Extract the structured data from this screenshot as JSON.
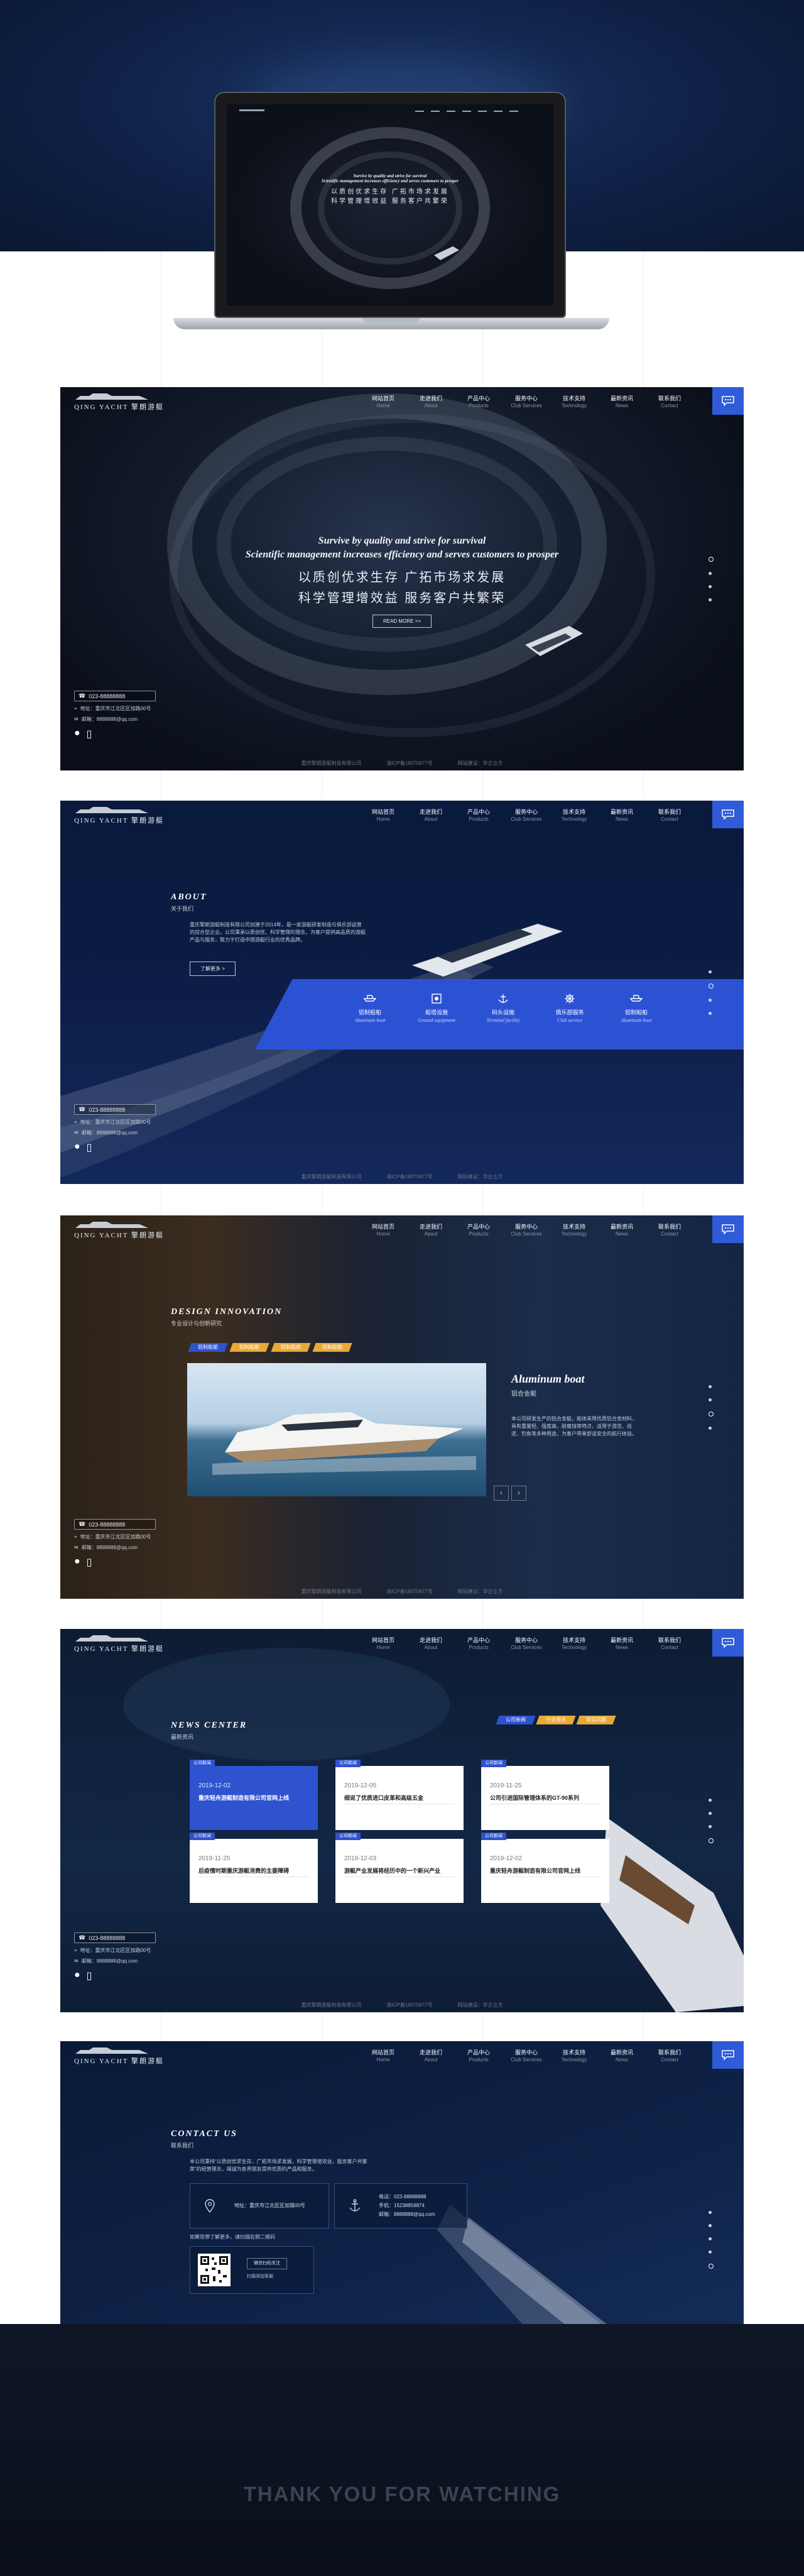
{
  "brand": {
    "name": "QING YACHT 擎朗游艇"
  },
  "nav": [
    {
      "cn": "网站首页",
      "en": "Home"
    },
    {
      "cn": "走进我们",
      "en": "About"
    },
    {
      "cn": "产品中心",
      "en": "Products"
    },
    {
      "cn": "服务中心",
      "en": "Club Services"
    },
    {
      "cn": "技术支持",
      "en": "Technology"
    },
    {
      "cn": "最新资讯",
      "en": "News"
    },
    {
      "cn": "联系我们",
      "en": "Contact"
    }
  ],
  "contact_box": {
    "phone": "023-88888888",
    "address": "地址：重庆市江北区区加路00号",
    "email": "邮箱：8888888@qq.com"
  },
  "footer": [
    "重庆擎朗游艇制造有限公司",
    "渝ICP备18070677号",
    "网站建设：华企立方"
  ],
  "hero": {
    "line1": "Survive by quality and strive for survival",
    "line2": "Scientific management increases efficiency and serves customers to prosper",
    "cn1": "以质创优求生存  广拓市场求发展",
    "cn2": "科学管理增效益  服务客户共繁荣",
    "button": "READ MORE >>"
  },
  "about": {
    "title_en": "ABOUT",
    "title_cn": "关于我们",
    "text": "重庆擎朗游艇制造有限公司创建于2014年，是一家游艇研发制造与俱乐部运营的综合型企业。公司秉承以质创优、科学管理的理念，为客户提供高品质的游艇产品与服务，致力于打造中国游艇行业的优秀品牌。",
    "more": "了解更多 >",
    "features": [
      {
        "cn": "铝制船舶",
        "en": "Aluminum boat"
      },
      {
        "cn": "船塔设施",
        "en": "Ground equipment"
      },
      {
        "cn": "码头设施",
        "en": "Terminal facility"
      },
      {
        "cn": "俱乐部服务",
        "en": "Club service"
      },
      {
        "cn": "铝制船舶",
        "en": "Aluminum boat"
      }
    ]
  },
  "design": {
    "title_en": "DESIGN INNOVATION",
    "title_cn": "专业设计与创新研究",
    "tabs": [
      "铝制船舶",
      "铝制船舶",
      "铝制船舶",
      "铝制船舶"
    ],
    "product_en": "Aluminum boat",
    "product_cn": "铝合金艇",
    "product_desc": "本公司研发生产的铝合金艇，船体采用优质铝合金材料，具有重量轻、强度高、耐腐蚀等特点，适用于游览、巡逻、钓鱼等多种用途，为客户带来舒适安全的航行体验。"
  },
  "news": {
    "title_en": "NEWS CENTER",
    "title_cn": "最新资讯",
    "tabs": [
      "公司新闻",
      "行业资讯",
      "常见问题"
    ],
    "cards": [
      {
        "badge": "公司新闻",
        "date": "2019-12-02",
        "title": "重庆轻舟游艇制造有限公司官网上线"
      },
      {
        "badge": "公司新闻",
        "date": "2019-12-05",
        "title": "细说了优质进口皮革和高级五金"
      },
      {
        "badge": "公司新闻",
        "date": "2019-11-25",
        "title": "公司引进国际管理体系的GT-90系列"
      },
      {
        "badge": "公司新闻",
        "date": "2019-11-25",
        "title": "后疫情时期重庆游艇消费的主要障碍"
      },
      {
        "badge": "公司新闻",
        "date": "2019-12-03",
        "title": "游艇产业发展将经历中的一个新兴产业"
      },
      {
        "badge": "公司新闻",
        "date": "2019-12-02",
        "title": "重庆轻舟游艇制造有限公司官网上线"
      }
    ]
  },
  "contact": {
    "title_en": "CONTACT US",
    "title_cn": "联系我们",
    "intro": "本公司秉持“以质创优求生存，广拓市场求发展，科学管理增效益，服务客户共繁荣”的经营理念，竭诚为各界朋友提供优质的产品和服务。",
    "address": "地址：重庆市江北区区加路00号",
    "phone": "电话：023-88888888",
    "mobile": "手机：15238859874",
    "email": "邮箱：8888888@qq.com",
    "follow": "如果您想了解更多，请扫描右侧二维码",
    "qr_btn1": "微信扫码关注",
    "qr_btn2": "扫描添加客服"
  },
  "thanks": "THANK YOU FOR WATCHING"
}
